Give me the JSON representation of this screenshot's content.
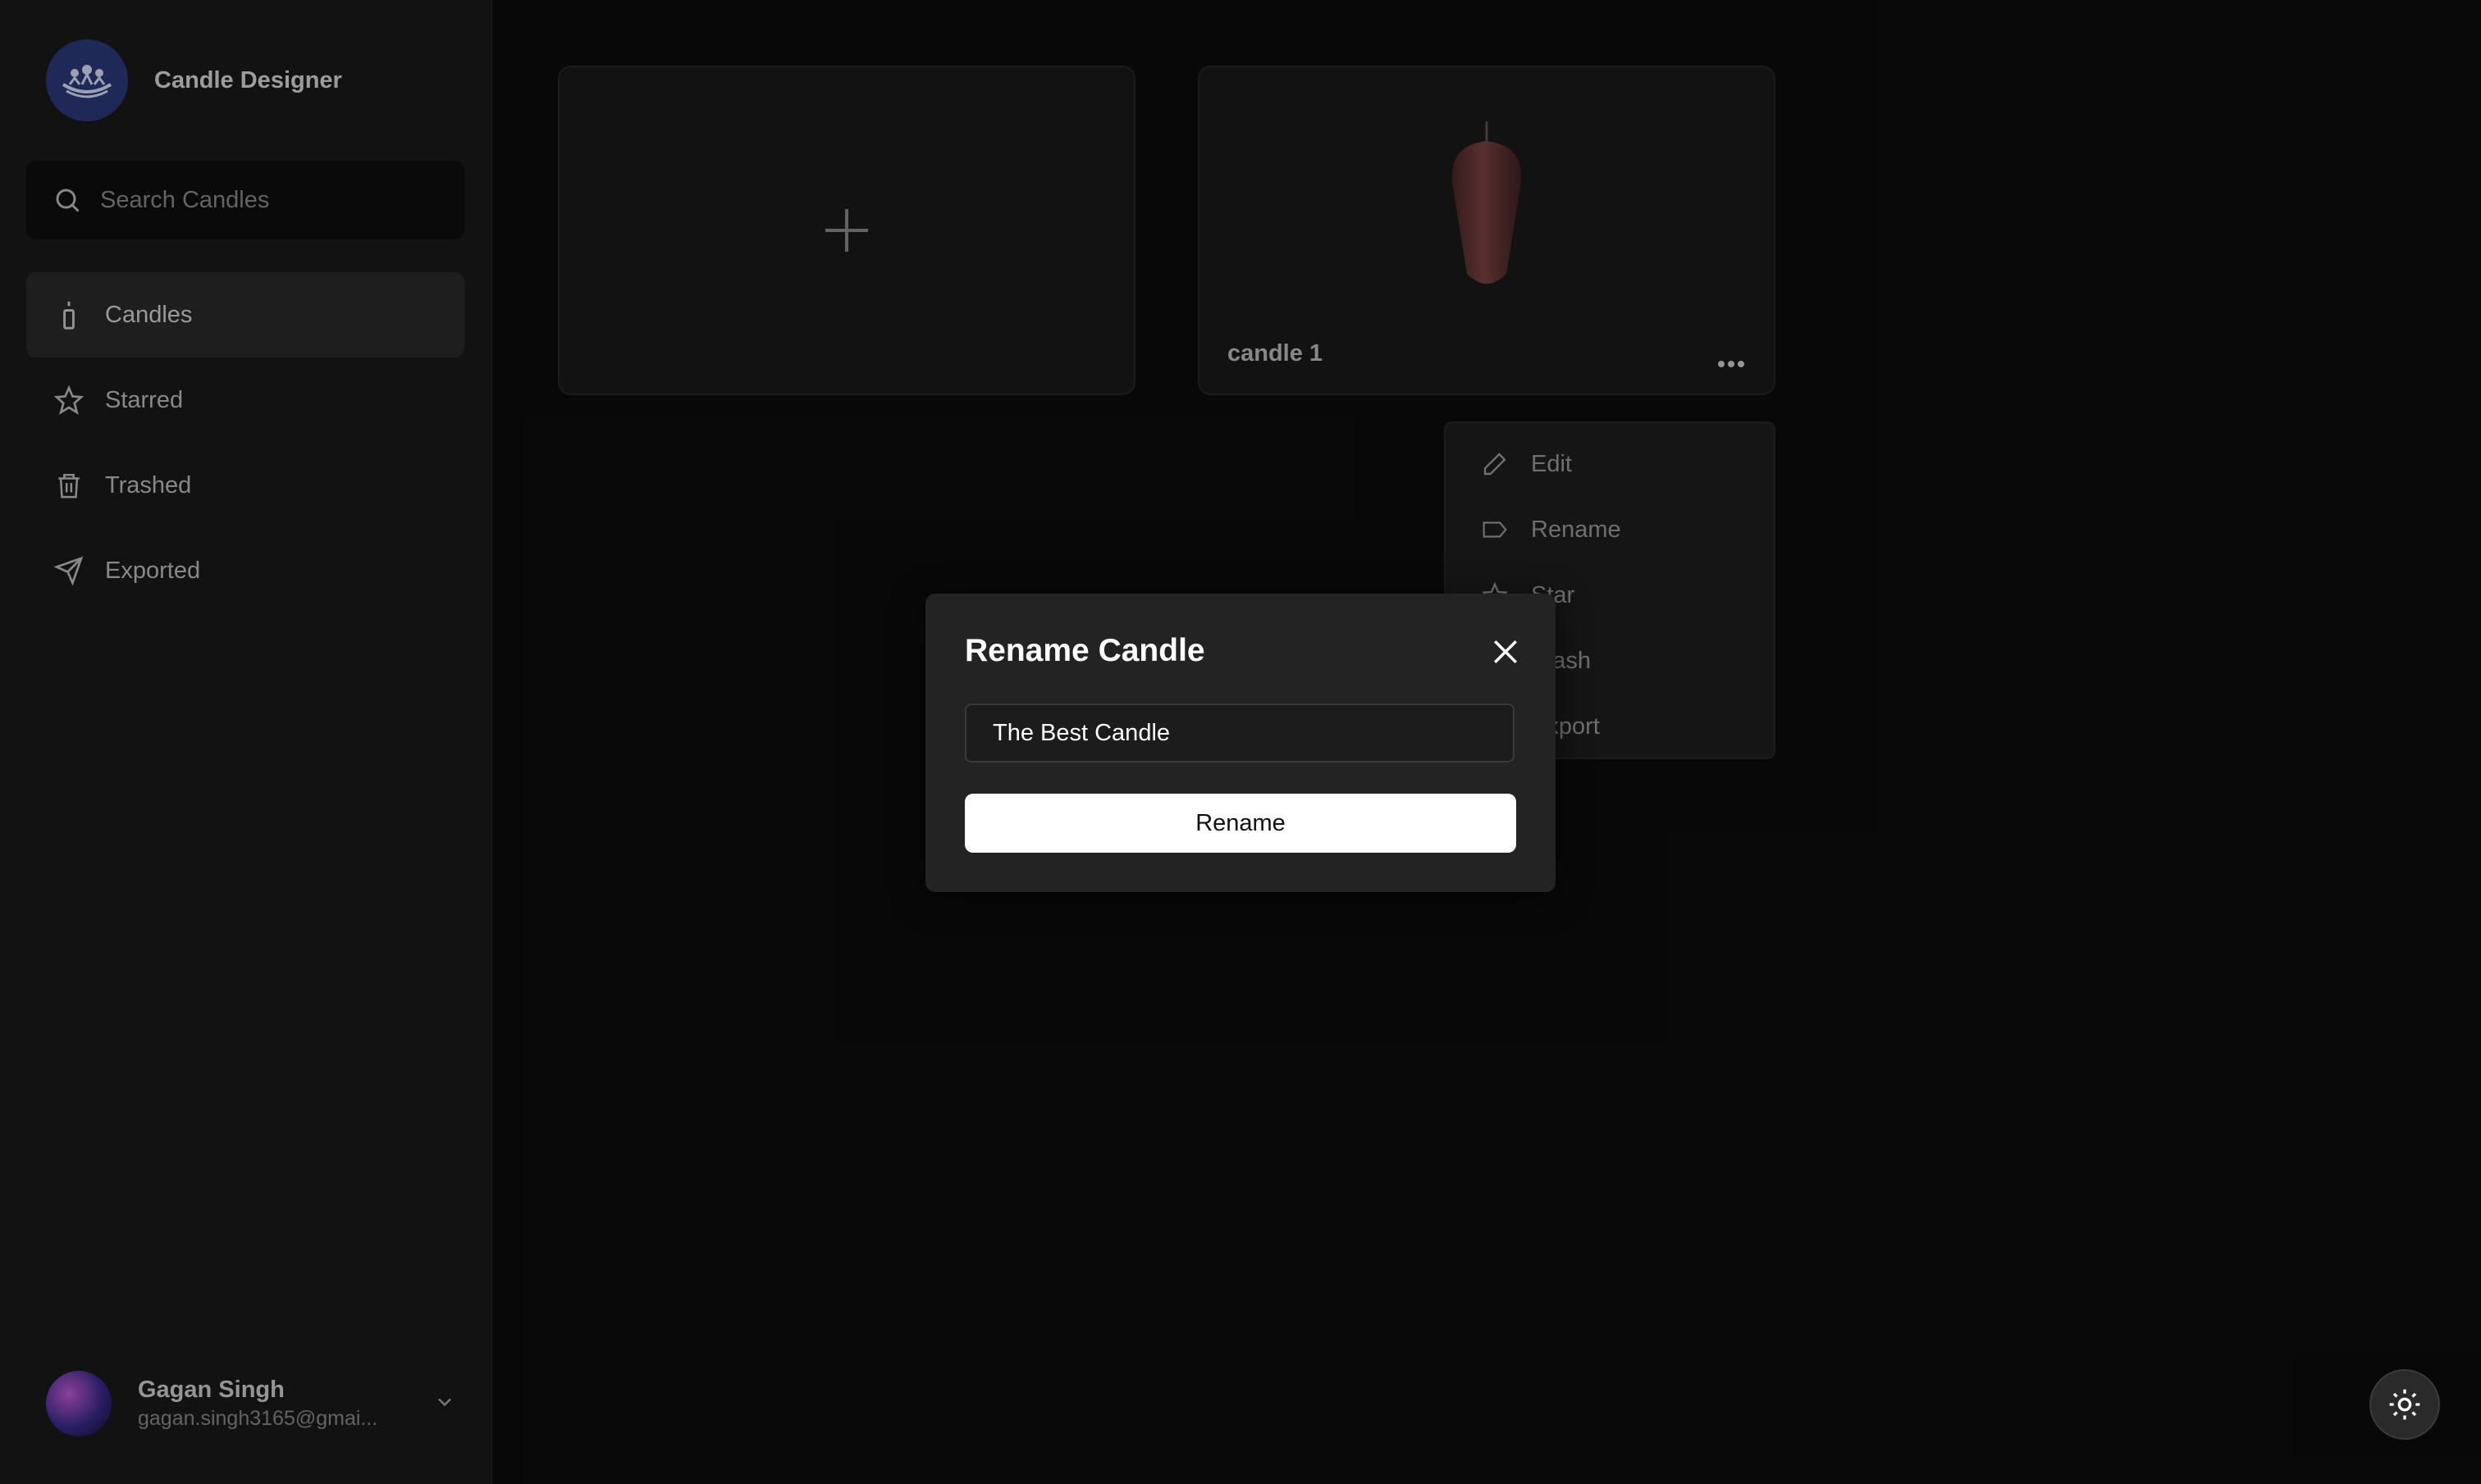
{
  "app": {
    "name": "Candle Designer"
  },
  "search": {
    "placeholder": "Search Candles"
  },
  "sidebar": {
    "items": [
      {
        "label": "Candles",
        "icon": "candle-icon",
        "active": true
      },
      {
        "label": "Starred",
        "icon": "star-icon"
      },
      {
        "label": "Trashed",
        "icon": "trash-icon"
      },
      {
        "label": "Exported",
        "icon": "send-icon"
      }
    ]
  },
  "user": {
    "name": "Gagan Singh",
    "email": "gagan.singh3165@gmai..."
  },
  "cards": [
    {
      "type": "new",
      "icon": "plus-icon"
    },
    {
      "type": "candle",
      "name": "candle 1"
    }
  ],
  "context_menu": {
    "items": [
      {
        "label": "Edit",
        "icon": "pencil-icon"
      },
      {
        "label": "Rename",
        "icon": "tag-icon"
      },
      {
        "label": "Star",
        "icon": "star-icon"
      },
      {
        "label": "Trash",
        "icon": "trash-icon"
      },
      {
        "label": "Export",
        "icon": "export-icon"
      }
    ]
  },
  "dialog": {
    "title": "Rename Candle",
    "input_value": "The Best Candle",
    "button_label": "Rename"
  },
  "colors": {
    "accent": "#ffffff",
    "background": "#0c0c0c",
    "sidebar": "#1a1a1a",
    "candle": "#6e3a3a"
  }
}
